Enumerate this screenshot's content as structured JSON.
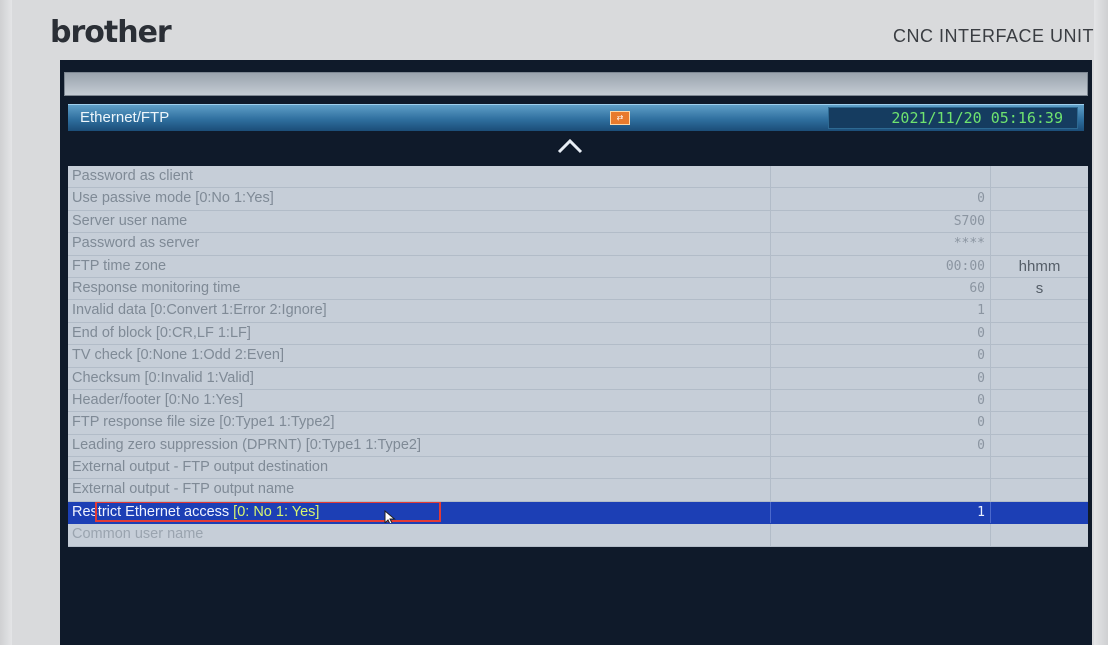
{
  "header": {
    "brand": "brother",
    "unit_label": "CNC INTERFACE UNIT"
  },
  "screen": {
    "title": "Ethernet/FTP",
    "datetime": "2021/11/20 05:16:39",
    "status_icon": "ethernet-status-icon",
    "colors": {
      "title_bar": "#2f6f9f",
      "clock_text": "#6fe36f",
      "row_background": "#c6ced8",
      "selected_row": "#1c3fb5",
      "highlight_text": "#d7f570",
      "annotation_box": "#e43a34"
    }
  },
  "rows": [
    {
      "label": "Password as client",
      "value": "",
      "unit": ""
    },
    {
      "label": "Use passive mode [0:No 1:Yes]",
      "value": "0",
      "unit": ""
    },
    {
      "label": "Server user name",
      "value": "S700",
      "unit": ""
    },
    {
      "label": "Password as server",
      "value": "****",
      "unit": ""
    },
    {
      "label": "FTP time zone",
      "value": "00:00",
      "unit": "hhmm"
    },
    {
      "label": "Response monitoring time",
      "value": "60",
      "unit": "s"
    },
    {
      "label": "Invalid data [0:Convert 1:Error 2:Ignore]",
      "value": "1",
      "unit": ""
    },
    {
      "label": "End of block [0:CR,LF 1:LF]",
      "value": "0",
      "unit": ""
    },
    {
      "label": "TV check [0:None 1:Odd 2:Even]",
      "value": "0",
      "unit": ""
    },
    {
      "label": "Checksum [0:Invalid 1:Valid]",
      "value": "0",
      "unit": ""
    },
    {
      "label": "Header/footer [0:No 1:Yes]",
      "value": "0",
      "unit": ""
    },
    {
      "label": "FTP response file size [0:Type1 1:Type2]",
      "value": "0",
      "unit": ""
    },
    {
      "label": "Leading zero suppression (DPRNT) [0:Type1 1:Type2]",
      "value": "0",
      "unit": ""
    },
    {
      "label": "External output - FTP output destination",
      "value": "",
      "unit": ""
    },
    {
      "label": "External output - FTP output name",
      "value": "",
      "unit": ""
    }
  ],
  "selected_row": {
    "label_main": "Restrict Ethernet access ",
    "label_options": "[0: No 1: Yes]",
    "value": "1",
    "unit": ""
  },
  "partial_row": {
    "label": "Common user name",
    "value": "",
    "unit": ""
  }
}
